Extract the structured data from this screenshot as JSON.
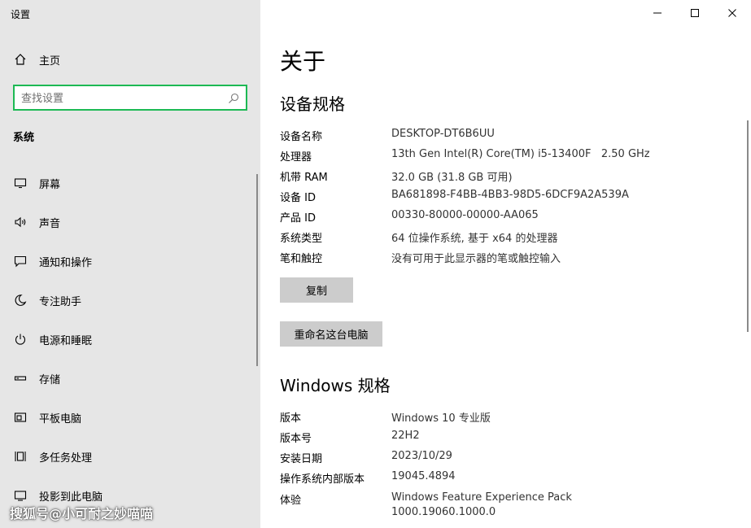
{
  "window": {
    "title": "设置"
  },
  "sidebar": {
    "home_label": "主页",
    "search_placeholder": "查找设置",
    "section_label": "系统",
    "items": [
      {
        "label": "屏幕",
        "icon": "monitor-icon"
      },
      {
        "label": "声音",
        "icon": "speaker-icon"
      },
      {
        "label": "通知和操作",
        "icon": "notification-icon"
      },
      {
        "label": "专注助手",
        "icon": "moon-icon"
      },
      {
        "label": "电源和睡眠",
        "icon": "power-icon"
      },
      {
        "label": "存储",
        "icon": "storage-icon"
      },
      {
        "label": "平板电脑",
        "icon": "tablet-icon"
      },
      {
        "label": "多任务处理",
        "icon": "multitask-icon"
      },
      {
        "label": "投影到此电脑",
        "icon": "project-icon"
      }
    ]
  },
  "watermark": "搜狐号@小可耐之妙喵喵",
  "main": {
    "title": "关于",
    "device_spec_title": "设备规格",
    "device_specs": [
      {
        "key": "设备名称",
        "value": "DESKTOP-DT6B6UU"
      },
      {
        "key": "处理器",
        "value": "13th Gen Intel(R) Core(TM) i5-13400F   2.50 GHz"
      },
      {
        "key": "机带 RAM",
        "value": "32.0 GB (31.8 GB 可用)"
      },
      {
        "key": "设备 ID",
        "value": "BA681898-F4BB-4BB3-98D5-6DCF9A2A539A"
      },
      {
        "key": "产品 ID",
        "value": "00330-80000-00000-AA065"
      },
      {
        "key": "系统类型",
        "value": "64 位操作系统, 基于 x64 的处理器"
      },
      {
        "key": "笔和触控",
        "value": "没有可用于此显示器的笔或触控输入"
      }
    ],
    "copy_button": "复制",
    "rename_button": "重命名这台电脑",
    "windows_spec_title": "Windows 规格",
    "windows_specs": [
      {
        "key": "版本",
        "value": "Windows 10 专业版"
      },
      {
        "key": "版本号",
        "value": "22H2"
      },
      {
        "key": "安装日期",
        "value": "2023/10/29"
      },
      {
        "key": "操作系统内部版本",
        "value": "19045.4894"
      },
      {
        "key": "体验",
        "value": "Windows Feature Experience Pack",
        "value2": "1000.19060.1000.0"
      }
    ]
  }
}
